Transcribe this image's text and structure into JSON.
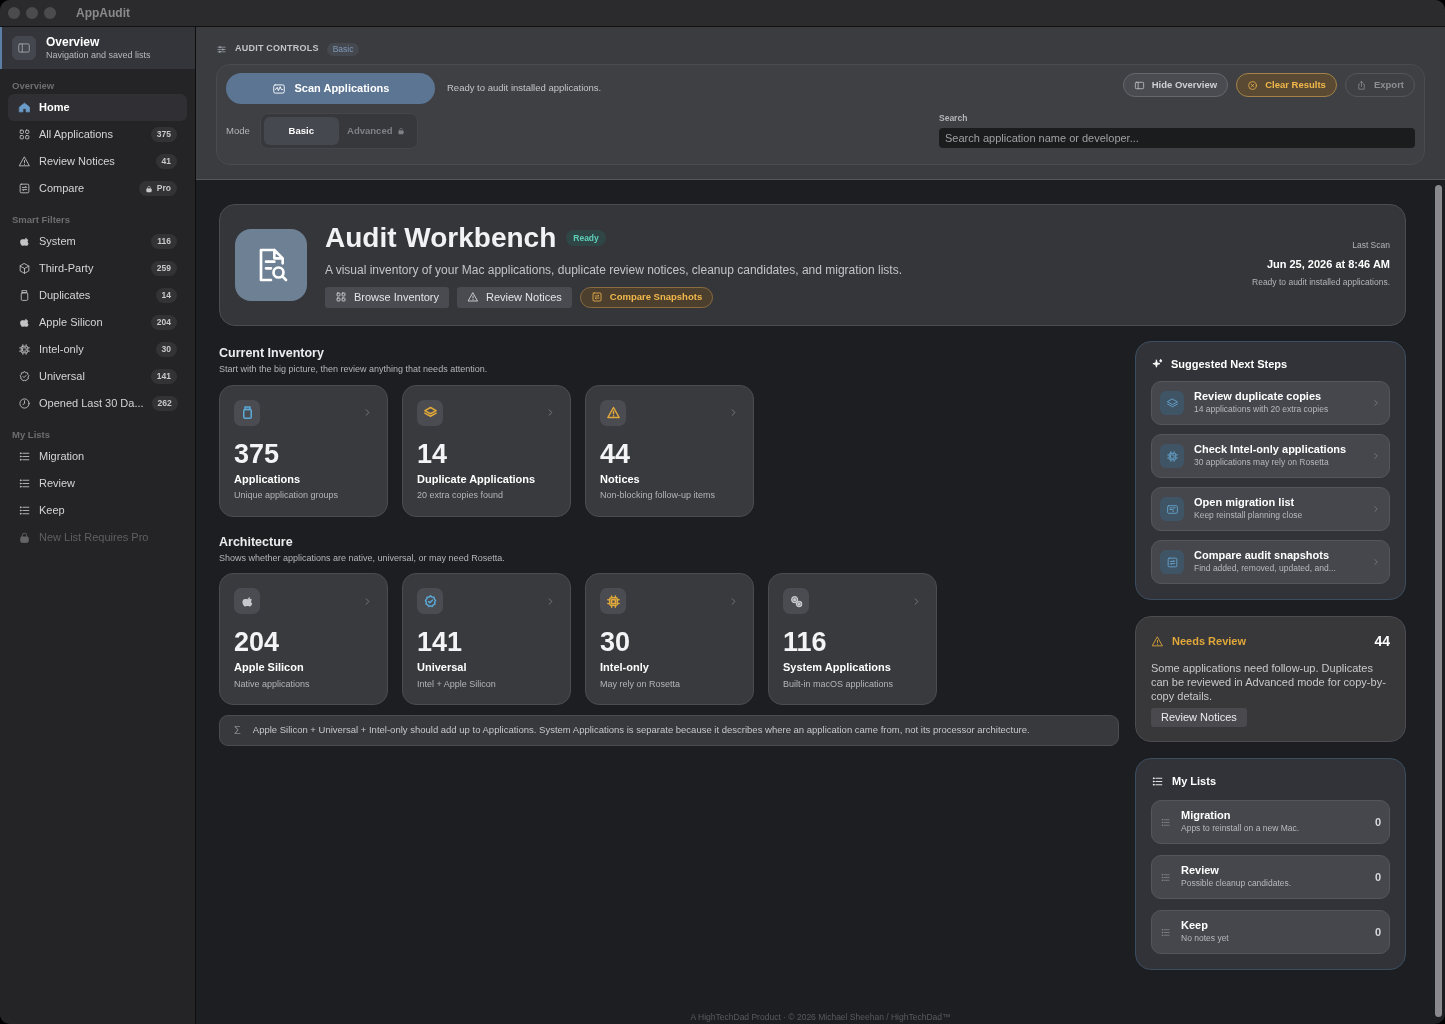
{
  "window": {
    "title": "AppAudit"
  },
  "sidebar": {
    "header": {
      "title": "Overview",
      "subtitle": "Navigation and saved lists"
    },
    "sections": [
      {
        "title": "Overview",
        "items": [
          {
            "label": "Home",
            "selected": true,
            "disabled": false
          },
          {
            "label": "All Applications",
            "count": "375",
            "selected": false,
            "disabled": false
          },
          {
            "label": "Review Notices",
            "count": "41",
            "selected": false,
            "disabled": false
          },
          {
            "label": "Compare",
            "count": "Pro",
            "locked": true,
            "selected": false,
            "disabled": false
          }
        ]
      },
      {
        "title": "Smart Filters",
        "items": [
          {
            "label": "System",
            "count": "116",
            "selected": false,
            "disabled": false
          },
          {
            "label": "Third-Party",
            "count": "259",
            "selected": false,
            "disabled": false
          },
          {
            "label": "Duplicates",
            "count": "14",
            "selected": false,
            "disabled": false
          },
          {
            "label": "Apple Silicon",
            "count": "204",
            "selected": false,
            "disabled": false
          },
          {
            "label": "Intel-only",
            "count": "30",
            "selected": false,
            "disabled": false
          },
          {
            "label": "Universal",
            "count": "141",
            "selected": false,
            "disabled": false
          },
          {
            "label": "Opened Last 30 Da...",
            "count": "262",
            "selected": false,
            "disabled": false
          }
        ]
      },
      {
        "title": "My Lists",
        "items": [
          {
            "label": "Migration",
            "selected": false,
            "disabled": false
          },
          {
            "label": "Review",
            "selected": false,
            "disabled": false
          },
          {
            "label": "Keep",
            "selected": false,
            "disabled": false
          },
          {
            "label": "New List Requires Pro",
            "selected": false,
            "disabled": true
          }
        ]
      }
    ]
  },
  "controls": {
    "title": "AUDIT CONTROLS",
    "mode_badge": "Basic",
    "scan_button": "Scan Applications",
    "status": "Ready to audit installed applications.",
    "mode_label": "Mode",
    "modes": [
      {
        "label": "Basic",
        "selected": true,
        "locked": false
      },
      {
        "label": "Advanced",
        "selected": false,
        "locked": true
      }
    ],
    "buttons": [
      {
        "label": "Hide Overview",
        "kind": "default",
        "disabled": false
      },
      {
        "label": "Clear Results",
        "kind": "warning",
        "disabled": false
      },
      {
        "label": "Export",
        "kind": "default",
        "disabled": true
      }
    ],
    "search": {
      "label": "Search",
      "placeholder": "Search application name or developer..."
    }
  },
  "hero": {
    "title": "Audit Workbench",
    "badge": "Ready",
    "description": "A visual inventory of your Mac applications, duplicate review notices, cleanup candidates, and migration lists.",
    "actions": [
      {
        "label": "Browse Inventory",
        "kind": "default"
      },
      {
        "label": "Review Notices",
        "kind": "default"
      },
      {
        "label": "Compare Snapshots",
        "kind": "accent"
      }
    ],
    "last_scan_label": "Last Scan",
    "last_scan": "Jun 25, 2026 at 8:46 AM",
    "last_scan_status": "Ready to audit installed applications."
  },
  "inventory": {
    "title": "Current Inventory",
    "subtitle": "Start with the big picture, then review anything that needs attention.",
    "cards": [
      {
        "value": "375",
        "label": "Applications",
        "sub": "Unique application groups",
        "color": "#5aa9d6"
      },
      {
        "value": "14",
        "label": "Duplicate Applications",
        "sub": "20 extra copies found",
        "color": "#e0a83a"
      },
      {
        "value": "44",
        "label": "Notices",
        "sub": "Non-blocking follow-up items",
        "color": "#e0a83a"
      }
    ]
  },
  "architecture": {
    "title": "Architecture",
    "subtitle": "Shows whether applications are native, universal, or may need Rosetta.",
    "cards": [
      {
        "value": "204",
        "label": "Apple Silicon",
        "sub": "Native applications",
        "color": "#c8c8cc"
      },
      {
        "value": "141",
        "label": "Universal",
        "sub": "Intel + Apple Silicon",
        "color": "#5aa9d6"
      },
      {
        "value": "30",
        "label": "Intel-only",
        "sub": "May rely on Rosetta",
        "color": "#e0a83a"
      },
      {
        "value": "116",
        "label": "System Applications",
        "sub": "Built-in macOS applications",
        "color": "#c8c8cc"
      }
    ],
    "note_symbol": "Σ",
    "note": "Apple Silicon + Universal + Intel-only should add up to Applications. System Applications is separate because it describes where an application came from, not its processor architecture."
  },
  "next_steps": {
    "title": "Suggested Next Steps",
    "items": [
      {
        "title": "Review duplicate copies",
        "sub": "14 applications with 20 extra copies"
      },
      {
        "title": "Check Intel-only applications",
        "sub": "30 applications may rely on Rosetta"
      },
      {
        "title": "Open migration list",
        "sub": "Keep reinstall planning close"
      },
      {
        "title": "Compare audit snapshots",
        "sub": "Find added, removed, updated, and..."
      }
    ]
  },
  "needs_review": {
    "title": "Needs Review",
    "count": "44",
    "text": "Some applications need follow-up. Duplicates can be reviewed in Advanced mode for copy-by-copy details.",
    "button": "Review Notices"
  },
  "my_lists": {
    "title": "My Lists",
    "items": [
      {
        "name": "Migration",
        "desc": "Apps to reinstall on a new Mac.",
        "count": "0"
      },
      {
        "name": "Review",
        "desc": "Possible cleanup candidates.",
        "count": "0"
      },
      {
        "name": "Keep",
        "desc": "No notes yet",
        "count": "0"
      }
    ]
  },
  "footer": "A HighTechDad Product · © 2026 Michael Sheehan / HighTechDad™"
}
